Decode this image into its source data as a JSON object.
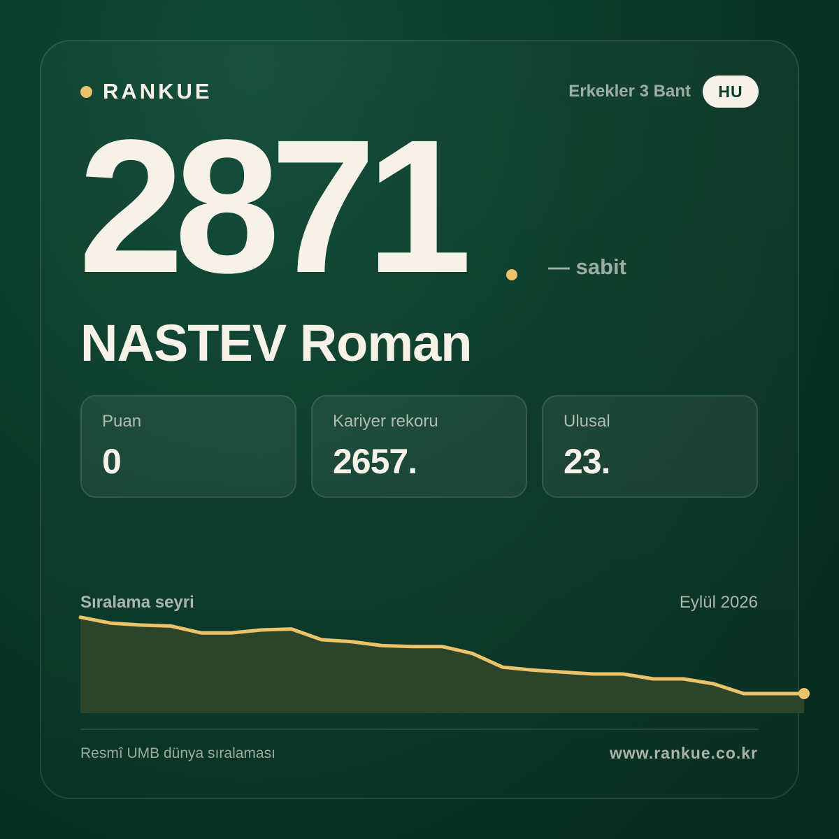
{
  "brand": {
    "name": "RANKUE",
    "accent_color": "#ecc36a"
  },
  "header": {
    "category": "Erkekler 3 Bant",
    "country_code": "HU"
  },
  "rank": {
    "value": "2871",
    "trend_label": "— sabit"
  },
  "player": {
    "name": "NASTEV Roman"
  },
  "stats": [
    {
      "label": "Puan",
      "value": "0"
    },
    {
      "label": "Kariyer rekoru",
      "value": "2657."
    },
    {
      "label": "Ulusal",
      "value": "23."
    }
  ],
  "chart": {
    "title": "Sıralama seyri",
    "date_label": "Eylül 2026"
  },
  "chart_data": {
    "type": "area",
    "title": "Sıralama seyri",
    "xlabel": "",
    "ylabel": "",
    "x": [
      1,
      2,
      3,
      4,
      5,
      6,
      7,
      8,
      9,
      10,
      11,
      12,
      13,
      14,
      15,
      16,
      17,
      18,
      19,
      20,
      21,
      22,
      23,
      24,
      25
    ],
    "series": [
      {
        "values": [
          98,
          92,
          90,
          89,
          82,
          82,
          85,
          86,
          75,
          73,
          69,
          68,
          68,
          61,
          47,
          44,
          42,
          40,
          40,
          35,
          35,
          30,
          20,
          20,
          20
        ]
      }
    ],
    "ylim": [
      0,
      100
    ],
    "grid": false,
    "legend": "none",
    "line_color": "#ecc36a",
    "fill_color": "#2c4429"
  },
  "footer": {
    "source": "Resmî UMB dünya sıralaması",
    "url": "www.rankue.co.kr"
  }
}
